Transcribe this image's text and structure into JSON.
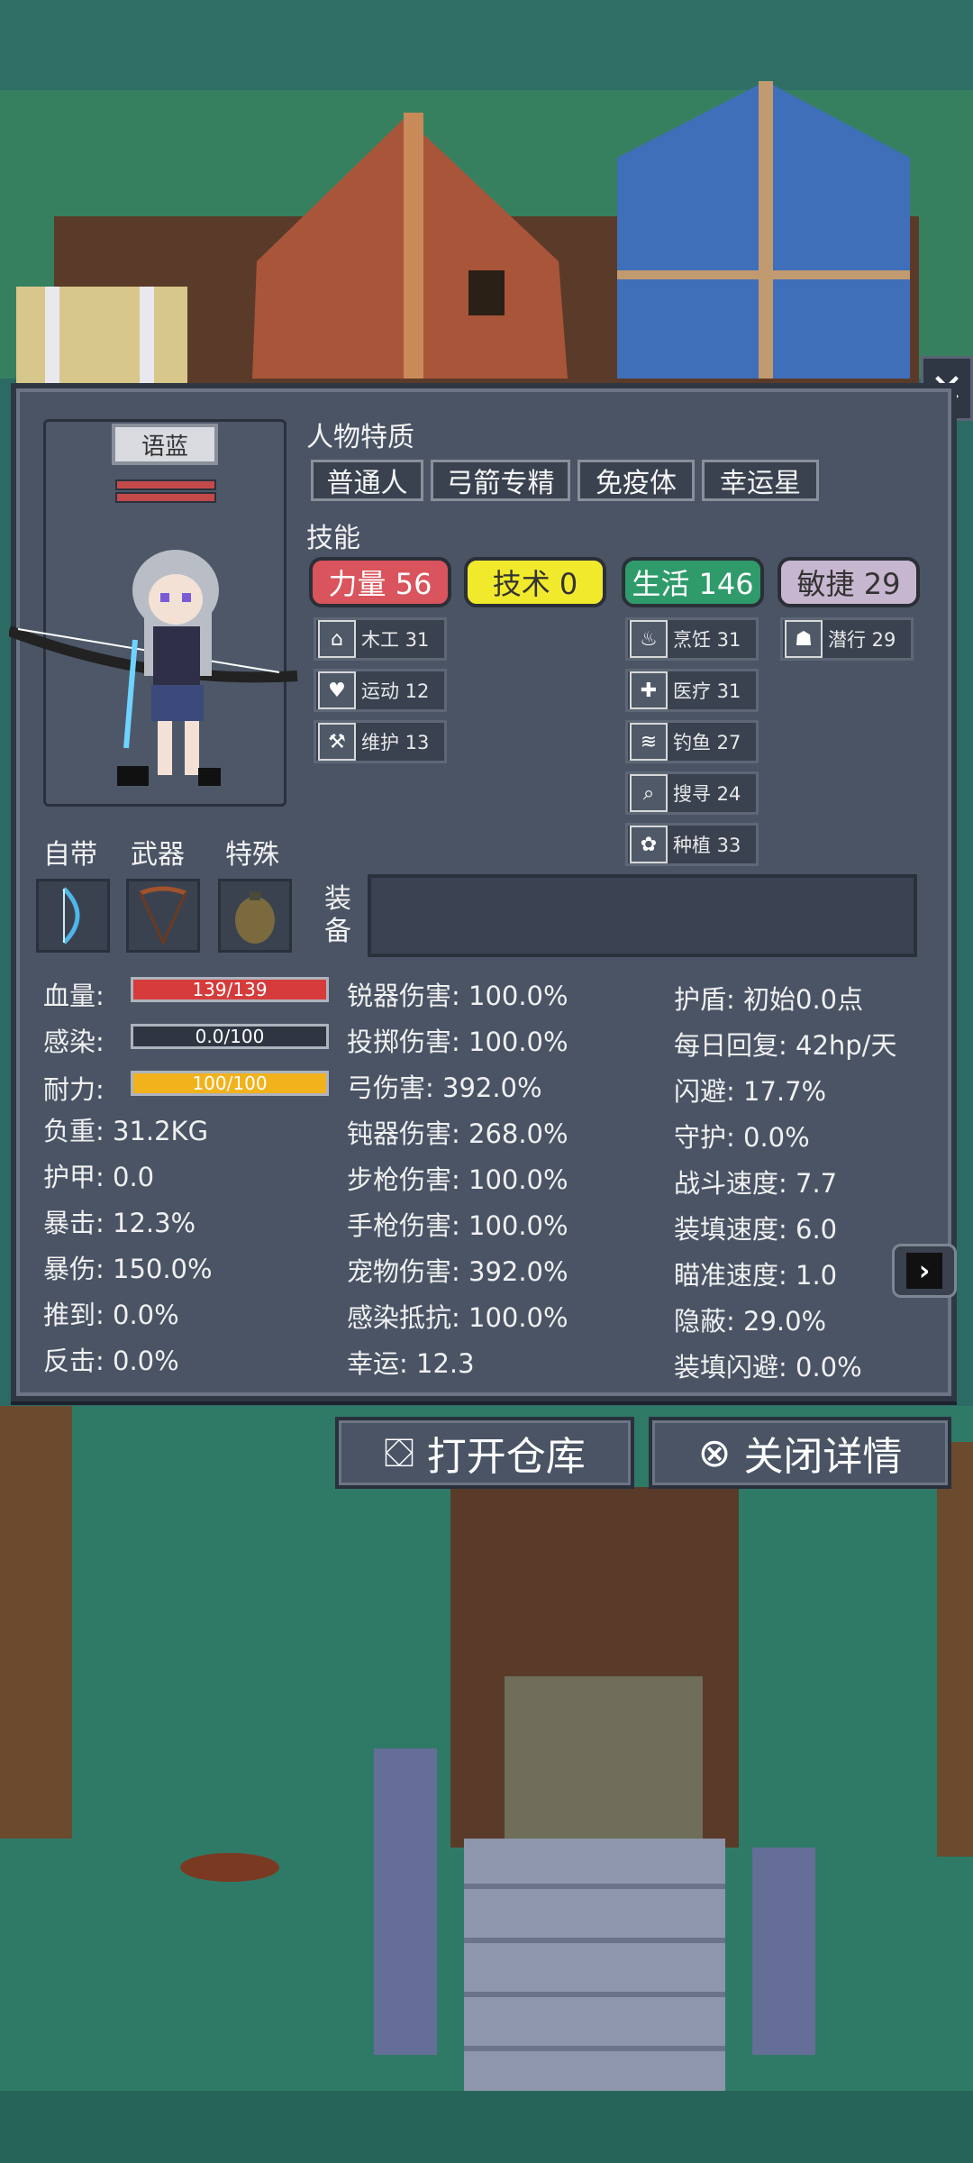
{
  "colors": {
    "panel": "#4a5465",
    "strength": "#d9545c",
    "technique": "#f1ea2c",
    "life": "#2f9b6b",
    "agility": "#c7b6d0",
    "hp_bar": "#d63b3b",
    "stamina_bar": "#f2b21c"
  },
  "panel": {
    "close_icon": "close-icon",
    "character_name": "语蓝",
    "traits_title": "人物特质",
    "traits": [
      "普通人",
      "弓箭专精",
      "免疫体",
      "幸运星"
    ],
    "skills_title": "技能",
    "main_skills": [
      {
        "label": "力量 56",
        "value": 56
      },
      {
        "label": "技术 0",
        "value": 0
      },
      {
        "label": "生活 146",
        "value": 146
      },
      {
        "label": "敏捷 29",
        "value": 29
      }
    ],
    "sub_skills_left": [
      {
        "icon": "house-icon",
        "label": "木工 31"
      },
      {
        "icon": "heart-icon",
        "label": "运动 12"
      },
      {
        "icon": "wrench-icon",
        "label": "维护 13"
      }
    ],
    "sub_skills_mid": [
      {
        "icon": "pot-icon",
        "label": "烹饪 31"
      },
      {
        "icon": "medkit-icon",
        "label": "医疗 31"
      },
      {
        "icon": "fish-icon",
        "label": "钓鱼 27"
      },
      {
        "icon": "magnifier-icon",
        "label": "搜寻 24"
      },
      {
        "icon": "flower-icon",
        "label": "种植 33"
      }
    ],
    "sub_skills_right": [
      {
        "icon": "sneak-icon",
        "label": "潜行 29"
      }
    ],
    "slots": {
      "self_label": "自带",
      "weapon_label": "武器",
      "special_label": "特殊",
      "equip_label": "装备"
    },
    "bars": {
      "hp_label": "血量:",
      "hp_text": "139/139",
      "hp_fraction": 1.0,
      "infection_label": "感染:",
      "infection_text": "0.0/100",
      "infection_fraction": 0.0,
      "stamina_label": "耐力:",
      "stamina_text": "100/100",
      "stamina_fraction": 1.0
    },
    "stats_left": [
      "负重: 31.2KG",
      "护甲: 0.0",
      "暴击: 12.3%",
      "暴伤: 150.0%",
      "推到: 0.0%",
      "反击: 0.0%"
    ],
    "stats_mid": [
      "锐器伤害: 100.0%",
      "投掷伤害: 100.0%",
      "弓伤害: 392.0%",
      "钝器伤害: 268.0%",
      "步枪伤害: 100.0%",
      "手枪伤害: 100.0%",
      "宠物伤害: 392.0%",
      "感染抵抗: 100.0%",
      "幸运: 12.3"
    ],
    "stats_right": [
      "护盾: 初始0.0点",
      "每日回复: 42hp/天",
      "闪避: 17.7%",
      "守护: 0.0%",
      "战斗速度: 7.7",
      "装填速度: 6.0",
      "瞄准速度: 1.0",
      "隐蔽: 29.0%",
      "装填闪避: 0.0%"
    ],
    "next_page_icon": "chevron-right-icon"
  },
  "actions": {
    "open_storage": "打开仓库",
    "close_details": "关闭详情"
  }
}
